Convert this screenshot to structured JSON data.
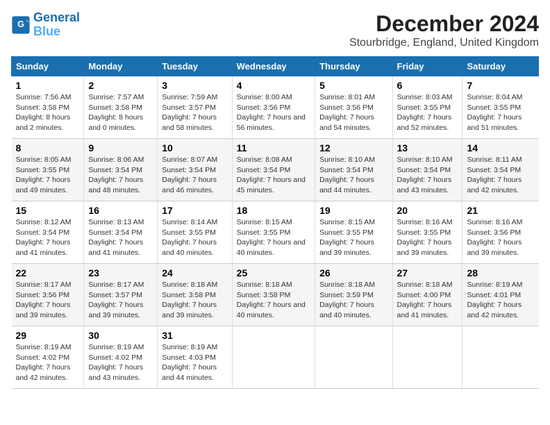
{
  "logo": {
    "line1": "General",
    "line2": "Blue"
  },
  "title": "December 2024",
  "subtitle": "Stourbridge, England, United Kingdom",
  "days_of_week": [
    "Sunday",
    "Monday",
    "Tuesday",
    "Wednesday",
    "Thursday",
    "Friday",
    "Saturday"
  ],
  "weeks": [
    [
      {
        "day": "1",
        "sunrise": "7:56 AM",
        "sunset": "3:58 PM",
        "daylight": "8 hours and 2 minutes."
      },
      {
        "day": "2",
        "sunrise": "7:57 AM",
        "sunset": "3:58 PM",
        "daylight": "8 hours and 0 minutes."
      },
      {
        "day": "3",
        "sunrise": "7:59 AM",
        "sunset": "3:57 PM",
        "daylight": "7 hours and 58 minutes."
      },
      {
        "day": "4",
        "sunrise": "8:00 AM",
        "sunset": "3:56 PM",
        "daylight": "7 hours and 56 minutes."
      },
      {
        "day": "5",
        "sunrise": "8:01 AM",
        "sunset": "3:56 PM",
        "daylight": "7 hours and 54 minutes."
      },
      {
        "day": "6",
        "sunrise": "8:03 AM",
        "sunset": "3:55 PM",
        "daylight": "7 hours and 52 minutes."
      },
      {
        "day": "7",
        "sunrise": "8:04 AM",
        "sunset": "3:55 PM",
        "daylight": "7 hours and 51 minutes."
      }
    ],
    [
      {
        "day": "8",
        "sunrise": "8:05 AM",
        "sunset": "3:55 PM",
        "daylight": "7 hours and 49 minutes."
      },
      {
        "day": "9",
        "sunrise": "8:06 AM",
        "sunset": "3:54 PM",
        "daylight": "7 hours and 48 minutes."
      },
      {
        "day": "10",
        "sunrise": "8:07 AM",
        "sunset": "3:54 PM",
        "daylight": "7 hours and 46 minutes."
      },
      {
        "day": "11",
        "sunrise": "8:08 AM",
        "sunset": "3:54 PM",
        "daylight": "7 hours and 45 minutes."
      },
      {
        "day": "12",
        "sunrise": "8:10 AM",
        "sunset": "3:54 PM",
        "daylight": "7 hours and 44 minutes."
      },
      {
        "day": "13",
        "sunrise": "8:10 AM",
        "sunset": "3:54 PM",
        "daylight": "7 hours and 43 minutes."
      },
      {
        "day": "14",
        "sunrise": "8:11 AM",
        "sunset": "3:54 PM",
        "daylight": "7 hours and 42 minutes."
      }
    ],
    [
      {
        "day": "15",
        "sunrise": "8:12 AM",
        "sunset": "3:54 PM",
        "daylight": "7 hours and 41 minutes."
      },
      {
        "day": "16",
        "sunrise": "8:13 AM",
        "sunset": "3:54 PM",
        "daylight": "7 hours and 41 minutes."
      },
      {
        "day": "17",
        "sunrise": "8:14 AM",
        "sunset": "3:55 PM",
        "daylight": "7 hours and 40 minutes."
      },
      {
        "day": "18",
        "sunrise": "8:15 AM",
        "sunset": "3:55 PM",
        "daylight": "7 hours and 40 minutes."
      },
      {
        "day": "19",
        "sunrise": "8:15 AM",
        "sunset": "3:55 PM",
        "daylight": "7 hours and 39 minutes."
      },
      {
        "day": "20",
        "sunrise": "8:16 AM",
        "sunset": "3:55 PM",
        "daylight": "7 hours and 39 minutes."
      },
      {
        "day": "21",
        "sunrise": "8:16 AM",
        "sunset": "3:56 PM",
        "daylight": "7 hours and 39 minutes."
      }
    ],
    [
      {
        "day": "22",
        "sunrise": "8:17 AM",
        "sunset": "3:56 PM",
        "daylight": "7 hours and 39 minutes."
      },
      {
        "day": "23",
        "sunrise": "8:17 AM",
        "sunset": "3:57 PM",
        "daylight": "7 hours and 39 minutes."
      },
      {
        "day": "24",
        "sunrise": "8:18 AM",
        "sunset": "3:58 PM",
        "daylight": "7 hours and 39 minutes."
      },
      {
        "day": "25",
        "sunrise": "8:18 AM",
        "sunset": "3:58 PM",
        "daylight": "7 hours and 40 minutes."
      },
      {
        "day": "26",
        "sunrise": "8:18 AM",
        "sunset": "3:59 PM",
        "daylight": "7 hours and 40 minutes."
      },
      {
        "day": "27",
        "sunrise": "8:18 AM",
        "sunset": "4:00 PM",
        "daylight": "7 hours and 41 minutes."
      },
      {
        "day": "28",
        "sunrise": "8:19 AM",
        "sunset": "4:01 PM",
        "daylight": "7 hours and 42 minutes."
      }
    ],
    [
      {
        "day": "29",
        "sunrise": "8:19 AM",
        "sunset": "4:02 PM",
        "daylight": "7 hours and 42 minutes."
      },
      {
        "day": "30",
        "sunrise": "8:19 AM",
        "sunset": "4:02 PM",
        "daylight": "7 hours and 43 minutes."
      },
      {
        "day": "31",
        "sunrise": "8:19 AM",
        "sunset": "4:03 PM",
        "daylight": "7 hours and 44 minutes."
      },
      null,
      null,
      null,
      null
    ]
  ]
}
